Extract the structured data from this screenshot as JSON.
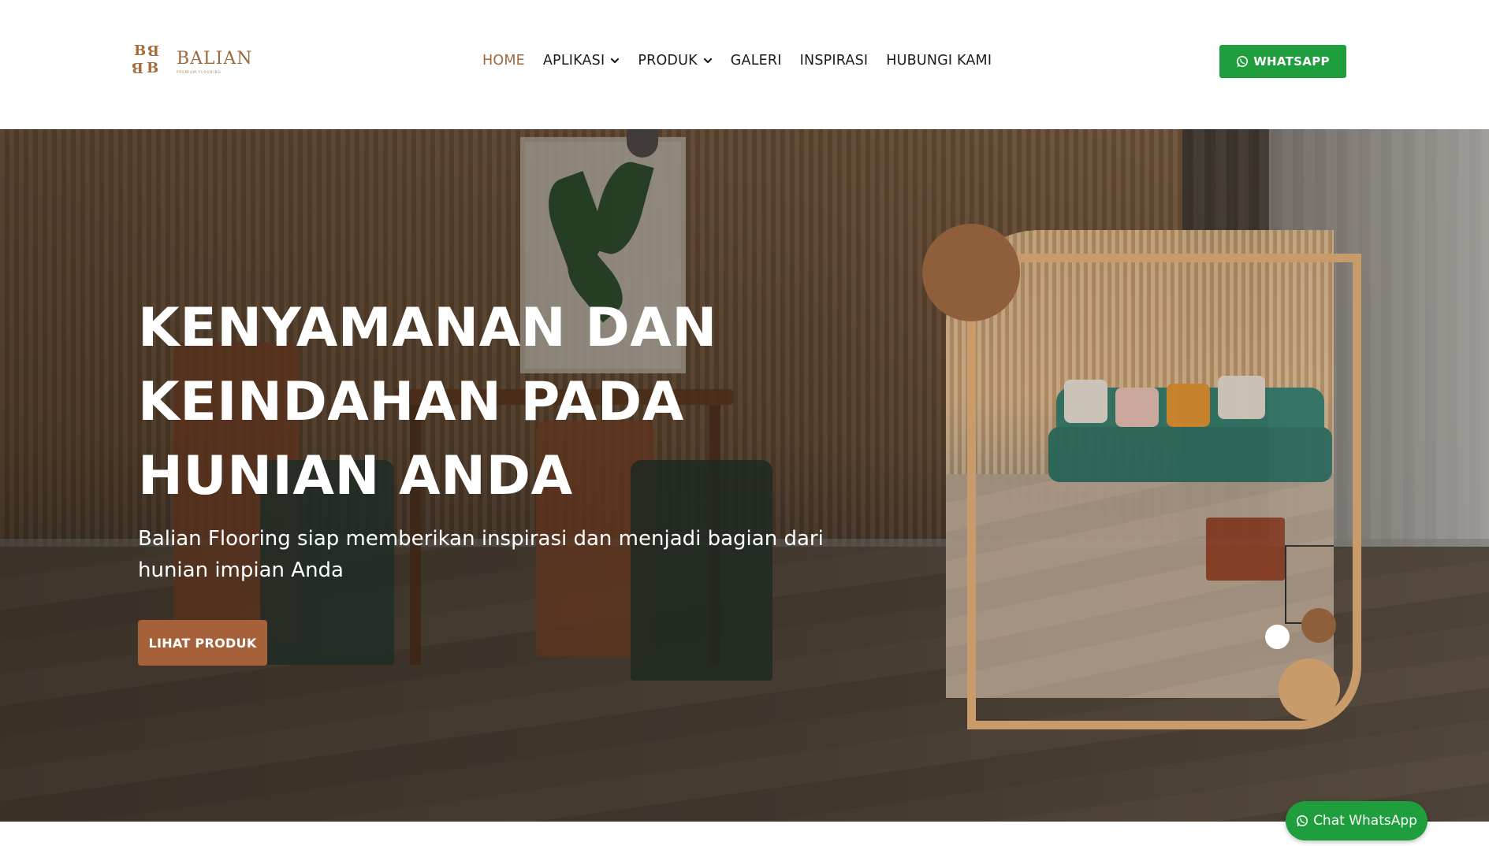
{
  "brand": {
    "name": "BALIAN",
    "tagline": "PREMIUM FLOORING"
  },
  "nav": {
    "items": [
      {
        "label": "HOME",
        "active": true,
        "dropdown": false
      },
      {
        "label": "APLIKASI",
        "active": false,
        "dropdown": true
      },
      {
        "label": "PRODUK",
        "active": false,
        "dropdown": true
      },
      {
        "label": "GALERI",
        "active": false,
        "dropdown": false
      },
      {
        "label": "INSPIRASI",
        "active": false,
        "dropdown": false
      },
      {
        "label": "HUBUNGI KAMI",
        "active": false,
        "dropdown": false
      }
    ]
  },
  "header_cta": {
    "label": "WHATSAPP",
    "icon": "whatsapp-icon"
  },
  "hero": {
    "title": "KENYAMANAN DAN KEINDAHAN PADA HUNIAN ANDA",
    "subtitle": "Balian Flooring siap memberikan inspirasi dan menjadi bagian dari hunian impian Anda",
    "cta_label": "LIHAT PRODUK"
  },
  "floating_chat": {
    "label": "Chat WhatsApp",
    "icon": "whatsapp-icon"
  },
  "colors": {
    "accent_brown": "#a6603a",
    "nav_active": "#9b6b3f",
    "whatsapp_green": "#1f9e3d",
    "frame_tan": "#c99a6a",
    "circle_brown": "#8e5f3a"
  }
}
